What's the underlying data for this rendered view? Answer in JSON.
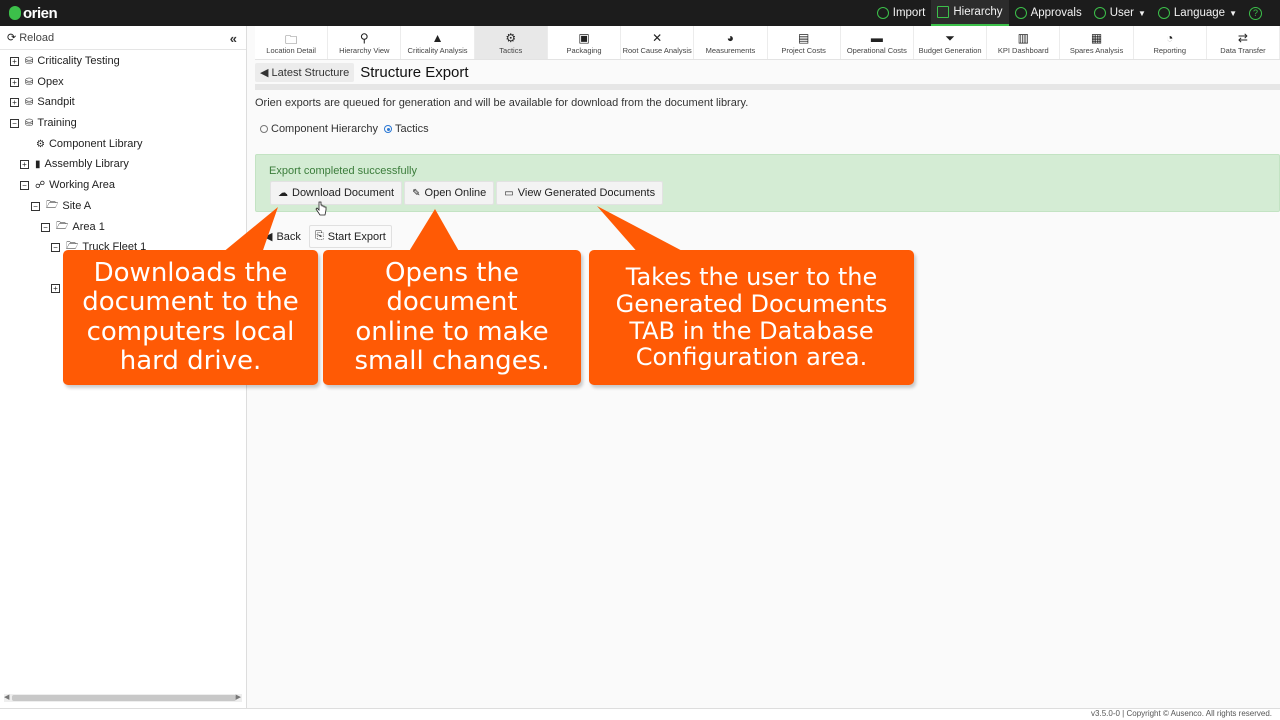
{
  "app": {
    "logo_text": "orien"
  },
  "topnav": [
    {
      "label": "Import",
      "icon": "lightbulb-icon",
      "active": false
    },
    {
      "label": "Hierarchy",
      "icon": "hierarchy-icon",
      "active": true
    },
    {
      "label": "Approvals",
      "icon": "check-circle-icon",
      "active": false
    },
    {
      "label": "User",
      "icon": "user-icon",
      "active": false
    },
    {
      "label": "Language",
      "icon": "globe-icon",
      "active": false
    },
    {
      "label": "",
      "icon": "help-icon",
      "active": false
    }
  ],
  "sidebar": {
    "reload_label": "Reload",
    "tree": [
      {
        "label": "Criticality Testing",
        "state": "+",
        "icon": "database-icon"
      },
      {
        "label": "Opex",
        "state": "+",
        "icon": "database-icon"
      },
      {
        "label": "Sandpit",
        "state": "+",
        "icon": "database-icon"
      },
      {
        "label": "Training",
        "state": "−",
        "icon": "database-icon"
      },
      {
        "label": "Component Library",
        "state": "",
        "icon": "gear-icon"
      },
      {
        "label": "Assembly Library",
        "state": "+",
        "icon": "book-icon"
      },
      {
        "label": "Working Area",
        "state": "−",
        "icon": "sitemap-icon"
      },
      {
        "label": "Site A",
        "state": "−",
        "icon": "folder-open-icon"
      },
      {
        "label": "Area 1",
        "state": "−",
        "icon": "folder-open-icon"
      },
      {
        "label": "Truck Fleet 1",
        "state": "−",
        "icon": "folder-open-icon"
      }
    ]
  },
  "toolbar": [
    {
      "label": "Location Detail",
      "icon": "folder-icon",
      "glyph": "🗀"
    },
    {
      "label": "Hierarchy View",
      "icon": "search-icon",
      "glyph": "⚲"
    },
    {
      "label": "Criticality Analysis",
      "icon": "warning-icon",
      "glyph": "▲"
    },
    {
      "label": "Tactics",
      "icon": "gear-icon",
      "glyph": "⚙",
      "active": true
    },
    {
      "label": "Packaging",
      "icon": "package-icon",
      "glyph": "▣"
    },
    {
      "label": "Root Cause Analysis",
      "icon": "tools-icon",
      "glyph": "✕"
    },
    {
      "label": "Measurements",
      "icon": "gauge-icon",
      "glyph": "◕"
    },
    {
      "label": "Project Costs",
      "icon": "file-dollar-icon",
      "glyph": "▤"
    },
    {
      "label": "Operational Costs",
      "icon": "card-icon",
      "glyph": "▬"
    },
    {
      "label": "Budget Generation",
      "icon": "filter-dollar-icon",
      "glyph": "⏷"
    },
    {
      "label": "KPI Dashboard",
      "icon": "bar-chart-icon",
      "glyph": "▥"
    },
    {
      "label": "Spares Analysis",
      "icon": "pallet-icon",
      "glyph": "▦"
    },
    {
      "label": "Reporting",
      "icon": "pie-chart-icon",
      "glyph": "◔"
    },
    {
      "label": "Data Transfer",
      "icon": "transfer-icon",
      "glyph": "⇄"
    }
  ],
  "main": {
    "back_label": "Latest Structure",
    "title": "Structure Export",
    "info": "Orien exports are queued for generation and will be available for download from the document library.",
    "radio_options": [
      {
        "label": "Component Hierarchy",
        "selected": false
      },
      {
        "label": "Tactics",
        "selected": true
      }
    ],
    "success_message": "Export completed successfully",
    "buttons": {
      "download": "Download Document",
      "open_online": "Open Online",
      "view_generated": "View Generated Documents"
    },
    "back_button": "Back",
    "start_export": "Start Export"
  },
  "callouts": [
    {
      "lines": [
        "Downloads the",
        "document to the",
        "computers local",
        "hard drive."
      ]
    },
    {
      "lines": [
        "Opens the",
        "document",
        "online to make",
        "small changes."
      ]
    },
    {
      "lines": [
        "Takes the user to the",
        "Generated Documents",
        "TAB in the Database",
        "Configuration area."
      ]
    }
  ],
  "status_bar": "v3.5.0-0 | Copyright © Ausenco. All rights reserved.",
  "colors": {
    "accent": "#3cc04a",
    "callout": "#ff5a05",
    "success_bg": "#d4ecd4",
    "topbar": "#1c1c1c"
  }
}
